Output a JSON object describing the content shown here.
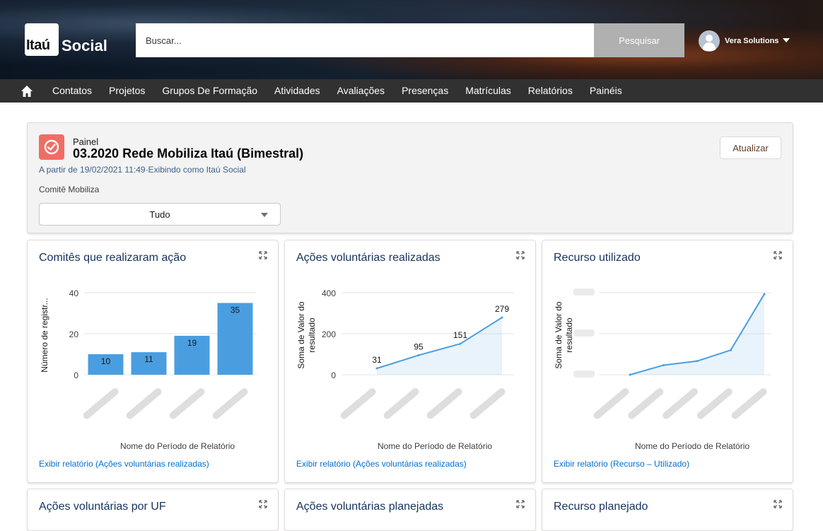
{
  "app": {
    "logo_part1": "Itaú",
    "logo_part2": "Social"
  },
  "search": {
    "placeholder": "Buscar...",
    "button_label": "Pesquisar"
  },
  "user": {
    "name": "Vera Solutions"
  },
  "nav": {
    "items": [
      "Contatos",
      "Projetos",
      "Grupos De Formação",
      "Atividades",
      "Avaliações",
      "Presenças",
      "Matrículas",
      "Relatórios",
      "Painéis"
    ]
  },
  "dashboard": {
    "eyebrow": "Painel",
    "title": "03.2020 Rede Mobiliza Itaú (Bimestral)",
    "meta": "A partir de 19/02/2021 11:49·Exibindo como Itaú Social",
    "refresh_label": "Atualizar",
    "filter": {
      "label": "Comitê Mobiliza",
      "value": "Tudo"
    },
    "colors": {
      "accent": "#4a9ee0",
      "icon": "#ef6e64",
      "link": "#0070d2",
      "title": "#16325c"
    }
  },
  "widgets": [
    {
      "title": "Comitês que realizaram ação",
      "link": "Exibir relatório (Ações voluntárias realizadas)",
      "chart_data": {
        "type": "bar",
        "ylabel": "Número de registr...",
        "xlabel": "Nome do Período de Relatório",
        "yticks": [
          "40",
          "20",
          "0"
        ],
        "ylim": [
          0,
          40
        ],
        "values": [
          10,
          11,
          19,
          35
        ],
        "labels": [
          "10",
          "11",
          "19",
          "35"
        ]
      }
    },
    {
      "title": "Ações voluntárias realizadas",
      "link": "Exibir relatório (Ações voluntárias realizadas)",
      "chart_data": {
        "type": "area",
        "ylabel_lines": [
          "Soma de Valor do",
          "resultado"
        ],
        "xlabel": "Nome do Período de Relatório",
        "yticks": [
          "400",
          "200",
          "0"
        ],
        "ylim": [
          0,
          400
        ],
        "values": [
          31,
          95,
          151,
          279
        ],
        "labels": [
          "31",
          "95",
          "151",
          "279"
        ]
      }
    },
    {
      "title": "Recurso utilizado",
      "link": "Exibir relatório (Recurso – Utilizado)",
      "chart_data": {
        "type": "area",
        "ylabel_lines": [
          "Soma de Valor do",
          "resultado"
        ],
        "xlabel": "Nome do Período de Relatório",
        "ylim": [
          0,
          300000
        ],
        "values": [
          0,
          35000,
          50000,
          90000,
          295000
        ]
      }
    },
    {
      "title": "Ações voluntárias por UF"
    },
    {
      "title": "Ações voluntárias planejadas"
    },
    {
      "title": "Recurso planejado"
    }
  ]
}
